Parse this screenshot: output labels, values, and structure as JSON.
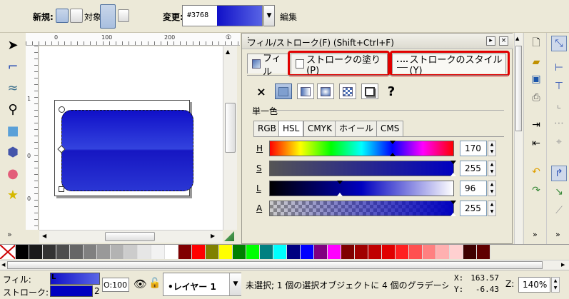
{
  "toolbar": {
    "new_label": "新規:",
    "object_label": "対象",
    "change_label": "変更:",
    "gradient_id": "#3768",
    "edit_label": "編集"
  },
  "tools": [
    {
      "name": "selector-tool",
      "icon": "arrow-icon"
    },
    {
      "name": "node-tool",
      "icon": "node-icon"
    },
    {
      "name": "tweak-tool",
      "icon": "wave-icon"
    },
    {
      "name": "zoom-tool",
      "icon": "magnifier-icon"
    },
    {
      "name": "rect-tool",
      "icon": "square-icon"
    },
    {
      "name": "3d-box-tool",
      "icon": "cube-icon"
    },
    {
      "name": "ellipse-tool",
      "icon": "circle-icon"
    },
    {
      "name": "star-tool",
      "icon": "star-icon"
    }
  ],
  "ruler_top": [
    "0",
    "100",
    "200"
  ],
  "ruler_left": [
    "1",
    "0",
    "0"
  ],
  "dialog": {
    "title": "フィル/ストローク(F) (Shift+Ctrl+F)",
    "tabs": [
      "フィル",
      "ストロークの塗り(P)",
      "ストロークのスタイル(Y)"
    ],
    "flat_color_title": "単一色",
    "color_tabs": [
      "RGB",
      "HSL",
      "CMYK",
      "ホイール",
      "CMS"
    ],
    "sliders": [
      {
        "label": "H",
        "value": "170",
        "level": 0.67
      },
      {
        "label": "S",
        "value": "255",
        "level": 1.0
      },
      {
        "label": "L",
        "value": "96",
        "level": 0.38
      },
      {
        "label": "A",
        "value": "255",
        "level": 1.0
      }
    ],
    "unknown_button": "?",
    "no_paint_button": "×"
  },
  "palette": [
    "#000000",
    "#1a1a1a",
    "#333333",
    "#4d4d4d",
    "#666666",
    "#808080",
    "#999999",
    "#b3b3b3",
    "#cccccc",
    "#e6e6e6",
    "#f2f2f2",
    "#ffffff",
    "#800000",
    "#ff0000",
    "#808000",
    "#ffff00",
    "#008000",
    "#00ff00",
    "#008080",
    "#00ffff",
    "#000080",
    "#0000ff",
    "#800080",
    "#ff00ff",
    "#800000",
    "#a00000",
    "#c00000",
    "#e00000",
    "#ff2020",
    "#ff5050",
    "#ff8080",
    "#ffb0b0",
    "#ffd0d0",
    "#400000",
    "#600000"
  ],
  "status": {
    "fill_label": "フィル:",
    "stroke_label": "ストローク:",
    "fill_flag": "L",
    "stroke_width": "2",
    "opacity_label": "O:",
    "opacity_value": "100",
    "layer_name": "•レイヤー 1",
    "message": "未選択; 1 個の選択オブジェクトに 4 個のグラデーシ",
    "x_label": "X:",
    "x_value": "163.57",
    "y_label": "Y:",
    "y_value": "-6.43",
    "zoom_label": "Z:",
    "zoom_value": "140%"
  }
}
